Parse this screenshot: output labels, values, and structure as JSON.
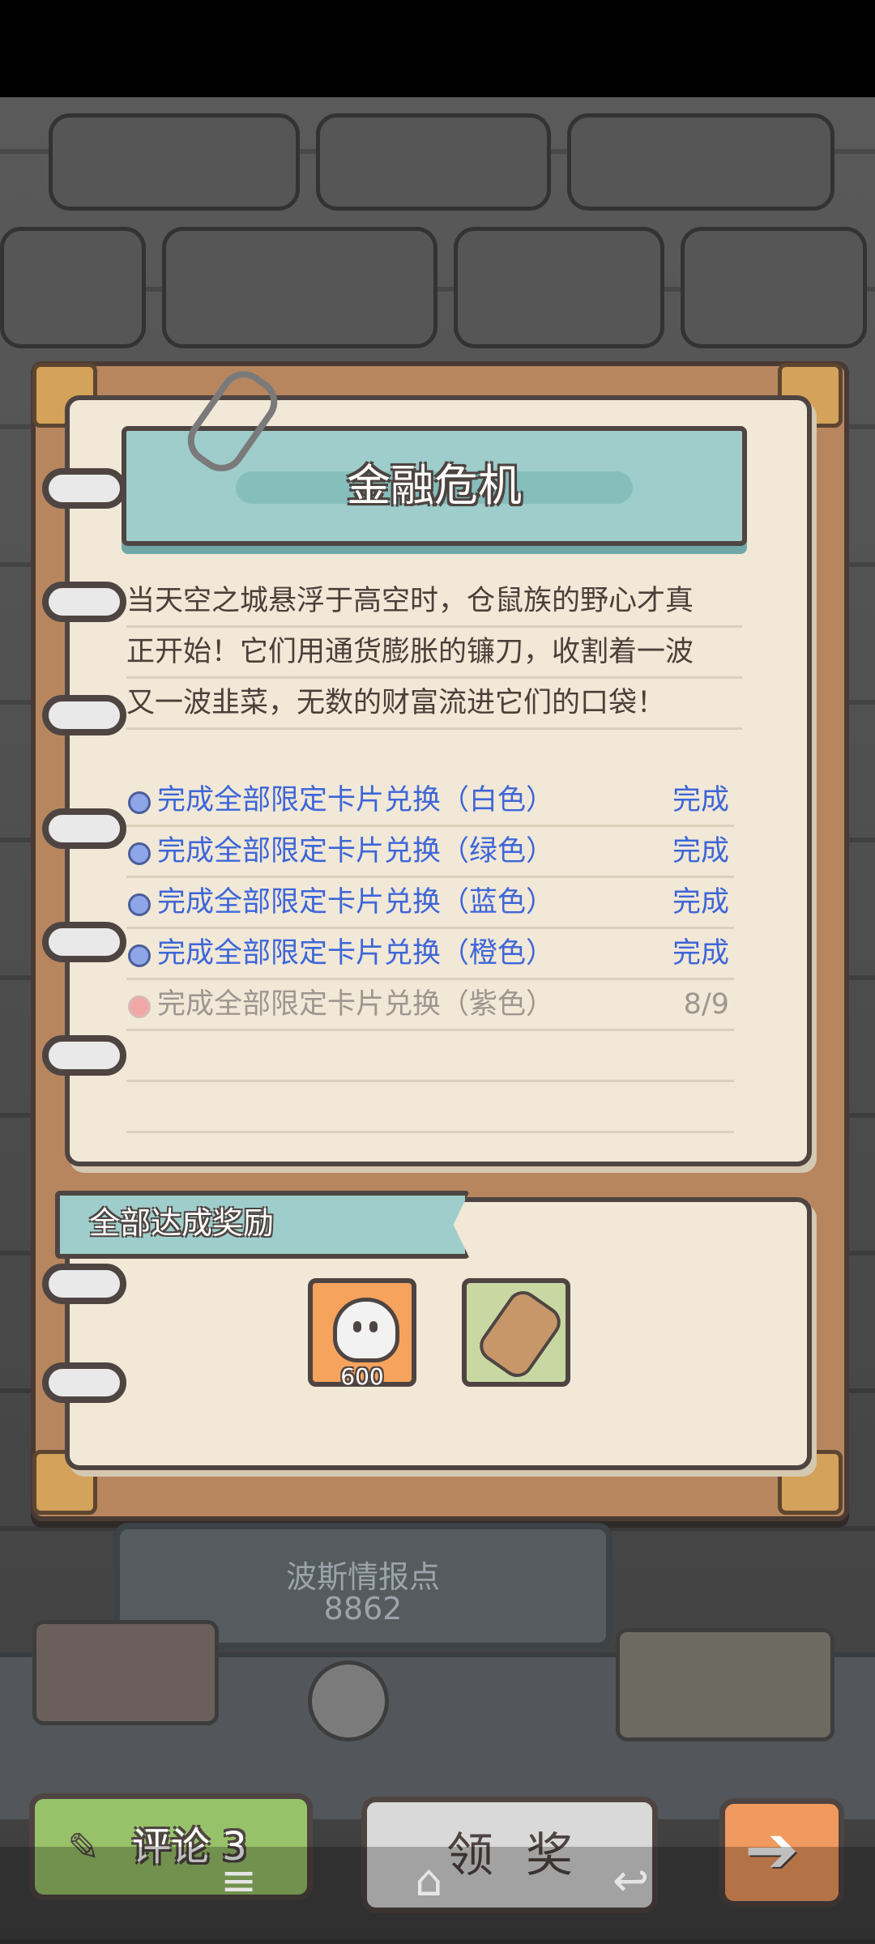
{
  "quest": {
    "title": "金融危机",
    "description_lines": [
      "当天空之城悬浮于高空时，仓鼠族的野心才真",
      "正开始！它们用通货膨胀的镰刀，收割着一波",
      "又一波韭菜，无数的财富流进它们的口袋！"
    ],
    "tasks": [
      {
        "label": "完成全部限定卡片兑换（白色）",
        "status": "完成",
        "completed": true
      },
      {
        "label": "完成全部限定卡片兑换（绿色）",
        "status": "完成",
        "completed": true
      },
      {
        "label": "完成全部限定卡片兑换（蓝色）",
        "status": "完成",
        "completed": true
      },
      {
        "label": "完成全部限定卡片兑换（橙色）",
        "status": "完成",
        "completed": true
      },
      {
        "label": "完成全部限定卡片兑换（紫色）",
        "status": "8/9",
        "completed": false
      }
    ]
  },
  "rewards": {
    "title": "全部达成奖励",
    "items": [
      {
        "icon": "ghost-icon",
        "count": "600"
      },
      {
        "icon": "scroll-icon",
        "count": ""
      }
    ]
  },
  "intel": {
    "label": "波斯情报点",
    "value": "8862"
  },
  "buttons": {
    "comment": "评论 3",
    "claim": "领奖",
    "next_icon": "arrow-right-icon"
  },
  "colors": {
    "done": "#3e66d8",
    "pending": "#9e9690",
    "banner": "#9fcdcb",
    "comment_button": "#98c26a",
    "next_button": "#f09a5f"
  }
}
